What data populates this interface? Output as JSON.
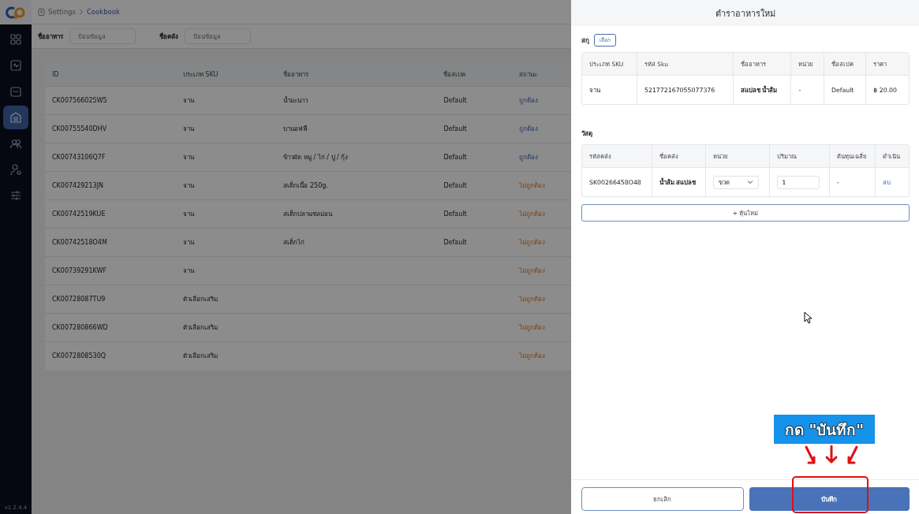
{
  "sidebar": {
    "items": [
      {
        "kind": "grid",
        "selected": false
      },
      {
        "kind": "pulse",
        "selected": false
      },
      {
        "kind": "bag",
        "selected": false
      },
      {
        "kind": "warehouse",
        "selected": true
      },
      {
        "kind": "users",
        "selected": false
      },
      {
        "kind": "user-settings",
        "selected": false
      },
      {
        "kind": "sliders",
        "selected": false
      }
    ],
    "version": "v1.2.4.4"
  },
  "breadcrumb": [
    {
      "label": "Settings",
      "current": false
    },
    {
      "label": "Cookbook",
      "current": true
    }
  ],
  "filters": [
    {
      "label": "ชื่ออาหาร",
      "placeholder": "ป้อนข้อมูล"
    },
    {
      "label": "ชื่อคลัง",
      "placeholder": "ป้อนข้อมูล"
    }
  ],
  "table": {
    "columns": [
      "ID",
      "ประเภท SKU",
      "ชื่ออาหาร",
      "ชื่อสเปค",
      "สถานะ"
    ],
    "rows": [
      {
        "id": "CK007566025W5",
        "sku_type": "จาน",
        "food_name": "น้ำมะนาว",
        "spec": "Default",
        "status": "ถูกต้อง",
        "valid": true
      },
      {
        "id": "CK00755540DHV",
        "sku_type": "จาน",
        "food_name": "บานอฟฟี่",
        "spec": "Default",
        "status": "ถูกต้อง",
        "valid": true
      },
      {
        "id": "CK00743106Q7F",
        "sku_type": "จาน",
        "food_name": "ข้าวผัด หมู / ไก่ / ปู / กุ้ง",
        "spec": "Default",
        "status": "ถูกต้อง",
        "valid": true
      },
      {
        "id": "CK007429213JN",
        "sku_type": "จาน",
        "food_name": "สเต็กเนื้อ 250g.",
        "spec": "Default",
        "status": "ไม่ถูกต้อง",
        "valid": false
      },
      {
        "id": "CK00742519KUE",
        "sku_type": "จาน",
        "food_name": "สเต็กปลาแซลม่อน",
        "spec": "Default",
        "status": "ไม่ถูกต้อง",
        "valid": false
      },
      {
        "id": "CK00742518O4M",
        "sku_type": "จาน",
        "food_name": "สเต็กไก่",
        "spec": "Default",
        "status": "ไม่ถูกต้อง",
        "valid": false
      },
      {
        "id": "CK00739291KWF",
        "sku_type": "จาน",
        "status": "ไม่ถูกต้อง",
        "valid": false
      },
      {
        "id": "CK00728087TU9",
        "sku_type": "ตัวเลือกเสริม",
        "status": "ไม่ถูกต้อง",
        "valid": false
      },
      {
        "id": "CK007280866WD",
        "sku_type": "ตัวเลือกเสริม",
        "status": "ไม่ถูกต้อง",
        "valid": false
      },
      {
        "id": "CK0072808530Q",
        "sku_type": "ตัวเลือกเสริม",
        "status": "ไม่ถูกต้อง",
        "valid": false
      }
    ]
  },
  "drawer": {
    "title": "ตำราอาหารใหม่",
    "sku_section": {
      "label": "สกุ",
      "button": "เลือก",
      "columns": [
        "ประเภท SKU",
        "รหัส Sku",
        "ชื่ออาหาร",
        "หน่วย",
        "ชื่อสเปค",
        "ราคา"
      ],
      "rows": [
        [
          "จาน",
          "521772167055077376",
          "สแปลช น้ำส้ม",
          "-",
          "Default",
          "฿ 20.00"
        ]
      ]
    },
    "material_section": {
      "label": "วัสดุ",
      "columns": [
        "รหัสคลัง",
        "ชื่อคลัง",
        "หน่วย",
        "ปริมาณ",
        "ต้นทุนเฉลี่ย",
        "ดำเนิน"
      ],
      "rows": [
        {
          "code": "SK00266458O48",
          "name": "น้ำส้ม สแปลช",
          "unit": "ขวด",
          "quantity": "1",
          "avg_cost": "-",
          "action": "ลบ"
        }
      ]
    },
    "add_button": "+ หุ้นใหม่",
    "cancel_button": "ยกเลิก",
    "save_button": "บันทึก"
  },
  "annotation": {
    "text": "กด \"บันทึก\""
  }
}
